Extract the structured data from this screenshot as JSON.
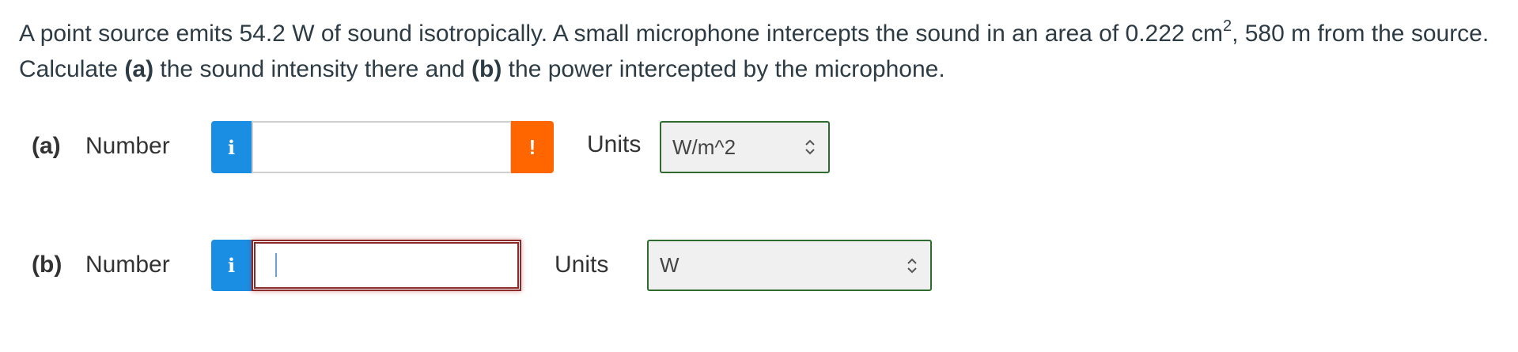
{
  "question": {
    "text_1": "A point source emits 54.2 W of sound isotropically. A small microphone intercepts the sound in an area of 0.222 cm",
    "sup": "2",
    "text_2": ", 580 m from the source. Calculate ",
    "bold_a": "(a)",
    "text_3": " the sound intensity there and ",
    "bold_b": "(b)",
    "text_4": " the power intercepted by the microphone."
  },
  "part_a": {
    "label": "(a)",
    "number_label": "Number",
    "info_icon": "i",
    "value": "",
    "warning_icon": "!",
    "units_label": "Units",
    "units_value": "W/m^2"
  },
  "part_b": {
    "label": "(b)",
    "number_label": "Number",
    "info_icon": "i",
    "value": "",
    "units_label": "Units",
    "units_value": "W"
  },
  "colors": {
    "info": "#1a8ee3",
    "warning": "#ff6600",
    "select_border": "#2f6b2f",
    "error_border": "#8b2a2a"
  }
}
